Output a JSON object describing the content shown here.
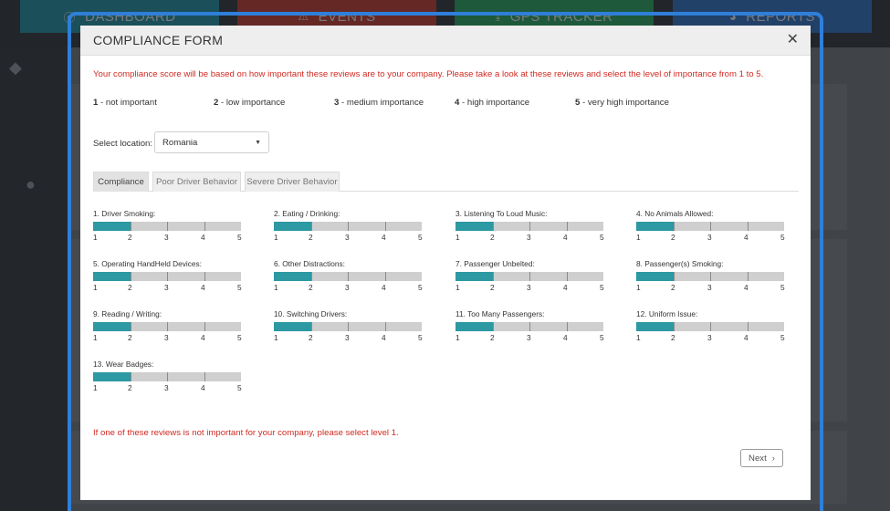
{
  "background": {
    "nav_tabs": [
      {
        "label": "DASHBOARD",
        "icon": "dashboard-icon",
        "glyph": "⦿"
      },
      {
        "label": "EVENTS",
        "icon": "warning-icon",
        "glyph": "⚠"
      },
      {
        "label": "GPS TRACKER",
        "icon": "download-icon",
        "glyph": "⤓"
      },
      {
        "label": "REPORTS",
        "icon": "pie-chart-icon",
        "glyph": "◕"
      }
    ],
    "colors": [
      "#1e8fa0",
      "#c0392b",
      "#23a55a",
      "#2c6fbf"
    ]
  },
  "modal": {
    "title": "COMPLIANCE FORM",
    "close_glyph": "✕",
    "intro": "Your compliance score will be based on how important these reviews are to your company. Please take a look at these reviews and select the level of importance from 1 to 5.",
    "legend": [
      {
        "num": "1",
        "text": " - not important"
      },
      {
        "num": "2",
        "text": " - low importance"
      },
      {
        "num": "3",
        "text": " - medium importance"
      },
      {
        "num": "4",
        "text": " - high importance"
      },
      {
        "num": "5",
        "text": " - very high importance"
      }
    ],
    "location": {
      "label": "Select location:",
      "value": "Romania"
    },
    "tabs": [
      "Compliance",
      "Poor Driver Behavior",
      "Severe Driver Behavior"
    ],
    "active_tab": "Compliance",
    "scale_labels": [
      "1",
      "2",
      "3",
      "4",
      "5"
    ],
    "items": [
      {
        "label": "1. Driver Smoking:",
        "level": 2
      },
      {
        "label": "2. Eating / Drinking:",
        "level": 2
      },
      {
        "label": "3. Listening To Loud Music:",
        "level": 2
      },
      {
        "label": "4. No Animals Allowed:",
        "level": 2
      },
      {
        "label": "5. Operating HandHeld Devices:",
        "level": 2
      },
      {
        "label": "6. Other Distractions:",
        "level": 2
      },
      {
        "label": "7. Passenger Unbelted:",
        "level": 2
      },
      {
        "label": "8. Passenger(s) Smoking:",
        "level": 2
      },
      {
        "label": "9. Reading / Writing:",
        "level": 2
      },
      {
        "label": "10. Switching Drivers:",
        "level": 2
      },
      {
        "label": "11. Too Many Passengers:",
        "level": 2
      },
      {
        "label": "12. Uniform Issue:",
        "level": 2
      },
      {
        "label": "13. Wear Badges:",
        "level": 2
      }
    ],
    "footer_note": "If one of these reviews is not important for your company, please select level 1.",
    "next_label": "Next",
    "next_glyph": "›"
  },
  "colors": {
    "accent": "#2c99a3",
    "warning_text": "#d02a22",
    "modal_border": "#2f7fd9"
  }
}
